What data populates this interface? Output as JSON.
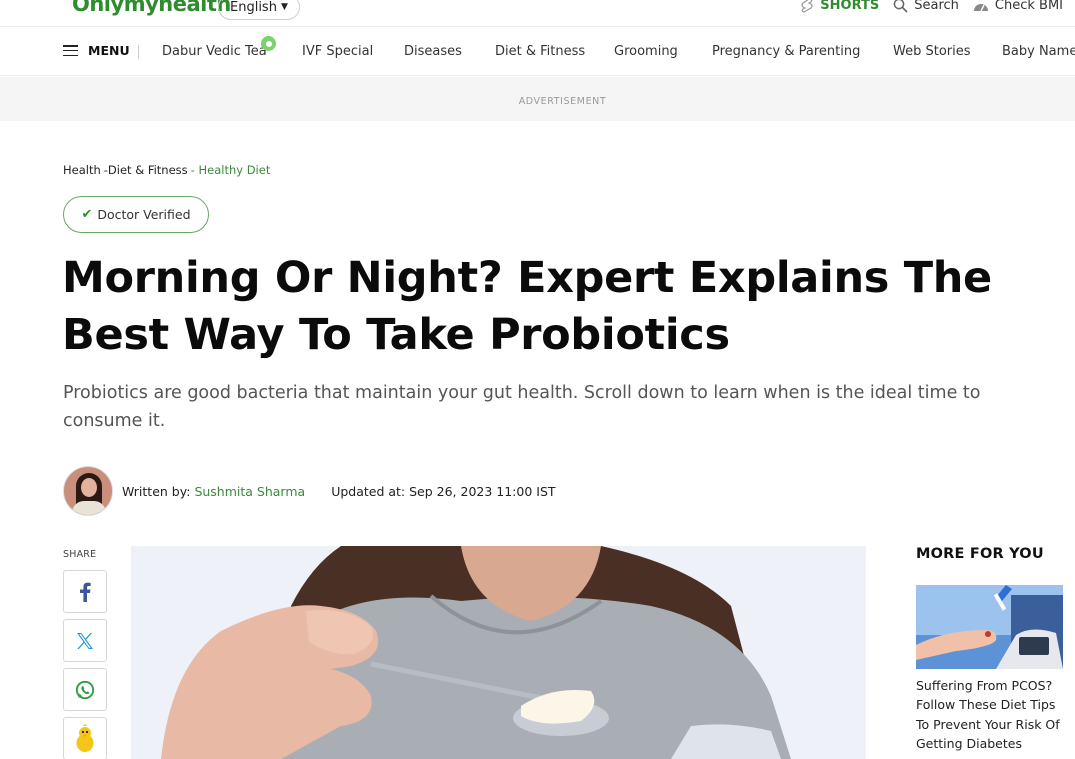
{
  "header": {
    "logo": "Onlymyhealth",
    "language": "English",
    "shorts_label": "SHORTS",
    "search_label": "Search",
    "bmi_label": "Check BMI"
  },
  "nav": {
    "menu_label": "MENU",
    "items": [
      "Dabur Vedic Tea",
      "IVF Special",
      "Diseases",
      "Diet & Fitness",
      "Grooming",
      "Pregnancy & Parenting",
      "Web Stories",
      "Baby Name"
    ]
  },
  "ad_label": "ADVERTISEMENT",
  "breadcrumb": {
    "items": [
      "Health",
      "-Diet & Fitness",
      "- Healthy Diet"
    ]
  },
  "badge": "Doctor Verified",
  "article": {
    "title": "Morning Or Night? Expert Explains The Best Way To Take Probiotics",
    "dek": "Probiotics are good bacteria that maintain your gut health. Scroll down to learn when is the ideal time to consume it.",
    "written_by_label": "Written by:",
    "author": "Sushmita Sharma",
    "updated": "Updated at: Sep 26, 2023 11:00 IST"
  },
  "share": {
    "label": "SHARE",
    "buttons": [
      "facebook-icon",
      "x-icon",
      "whatsapp-icon",
      "koo-icon"
    ]
  },
  "more_for_you": {
    "title": "MORE FOR YOU",
    "items": [
      {
        "title": "Suffering From PCOS? Follow These Diet Tips To Prevent Your Risk Of Getting Diabetes"
      }
    ]
  },
  "colors": {
    "brand_green": "#2e8b2e",
    "link_green": "#3a8a3a"
  }
}
